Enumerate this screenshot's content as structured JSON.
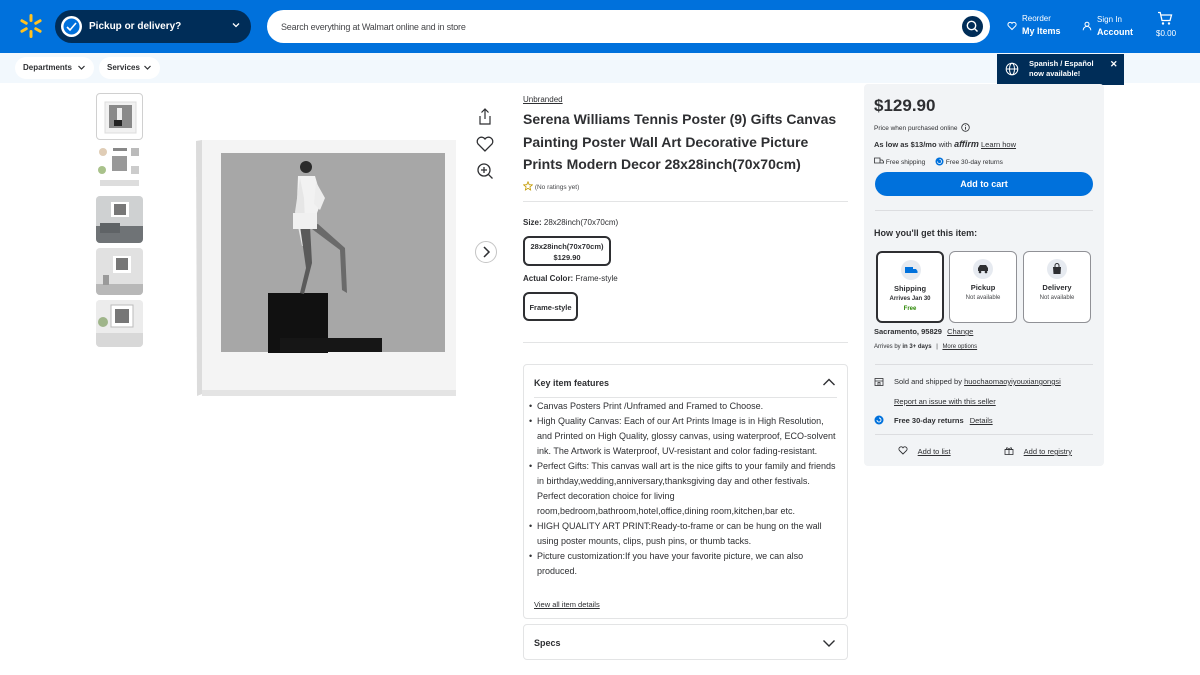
{
  "header": {
    "pickup_label": "Pickup or delivery?",
    "search_placeholder": "Search everything at Walmart online and in store",
    "reorder_small": "Reorder",
    "reorder_big": "My Items",
    "signin_small": "Sign In",
    "signin_big": "Account",
    "cart_amount": "$0.00",
    "brand_color": "#0071dc"
  },
  "subnav": {
    "departments": "Departments",
    "services": "Services"
  },
  "toast": {
    "line1": "Spanish / Español",
    "line2": "now available!"
  },
  "product": {
    "brand": "Unbranded",
    "title": "Serena Williams Tennis Poster (9) Gifts Canvas Painting Poster Wall Art Decorative Picture Prints Modern Decor 28x28inch(70x70cm)",
    "ratings": "(No ratings yet)",
    "size_label": "Size:",
    "size_value": "28x28inch(70x70cm)",
    "size_option": "28x28inch(70x70cm)",
    "size_option_price": "$129.90",
    "color_label": "Actual Color:",
    "color_value": "Frame-style",
    "color_option": "Frame-style"
  },
  "key_features": {
    "title": "Key item features",
    "items": [
      "Canvas Posters Print /Unframed and Framed to Choose.",
      "High Quality Canvas: Each of our Art Prints Image is in High Resolution, and Printed on High Quality, glossy canvas, using waterproof, ECO-solvent ink. The Artwork is Waterproof, UV-resistant and color fading-resistant.",
      "Perfect Gifts: This canvas wall art is the nice gifts to your family and friends in birthday,wedding,anniversary,thanksgiving day and other festivals. Perfect decoration choice for living room,bedroom,bathroom,hotel,office,dining room,kitchen,bar etc.",
      "HIGH QUALITY ART PRINT:Ready-to-frame or can be hung on the wall using poster mounts, clips, push pins, or thumb tacks.",
      "Picture customization:If you have your favorite picture, we can also produced."
    ],
    "view_all": "View all item details"
  },
  "specs": {
    "title": "Specs"
  },
  "buybox": {
    "price": "$129.90",
    "price_note": "Price when purchased online",
    "affirm_prefix": "As low as $13/mo",
    "affirm_with": "with",
    "affirm_brand": "affirm",
    "learn_how": "Learn how",
    "free_shipping": "Free shipping",
    "free_returns": "Free 30-day returns",
    "add_to_cart": "Add to cart",
    "how_title": "How you'll get this item:",
    "options": [
      {
        "title": "Shipping",
        "sub": "Arrives Jan 30",
        "extra": "Free"
      },
      {
        "title": "Pickup",
        "sub": "Not available",
        "extra": ""
      },
      {
        "title": "Delivery",
        "sub": "Not available",
        "extra": ""
      }
    ],
    "location": "Sacramento, 95829",
    "change": "Change",
    "arrives_prefix": "Arrives by",
    "arrives_days": "in 3+ days",
    "more_options": "More options",
    "sold_by_prefix": "Sold and shipped by",
    "seller": "huochaomaoyiyouxiangongsi",
    "report": "Report an issue with this seller",
    "returns_label": "Free 30-day returns",
    "details": "Details",
    "add_to_list": "Add to list",
    "add_to_registry": "Add to registry"
  }
}
